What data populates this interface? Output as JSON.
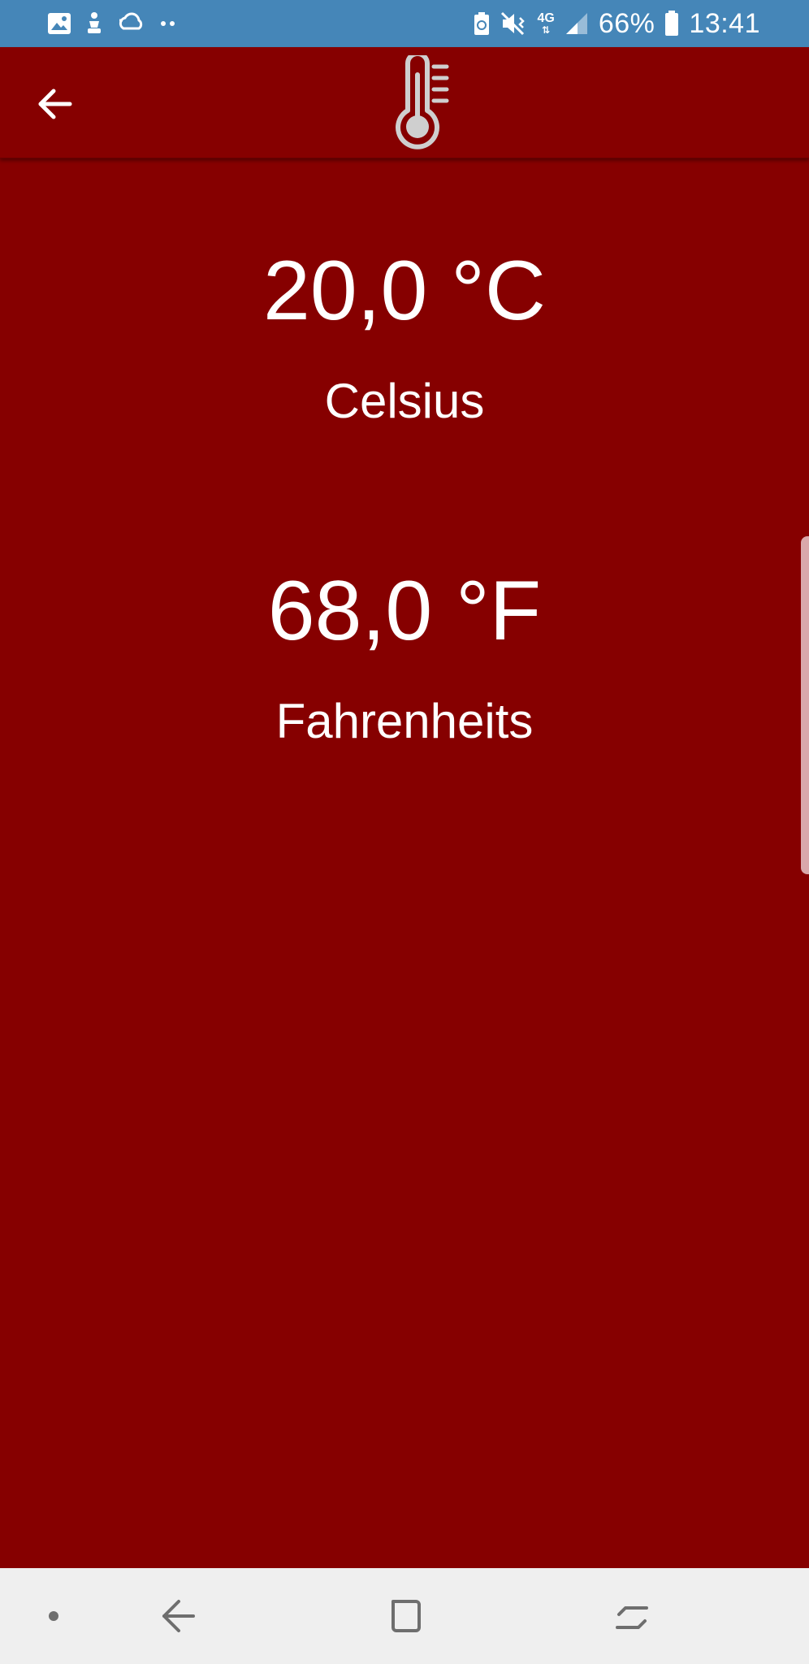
{
  "status_bar": {
    "battery_percent": "66%",
    "time": "13:41",
    "network_label": "4G",
    "icons": [
      "image-icon",
      "notification-figure-icon",
      "weather-cloud-icon",
      "more-dots-icon",
      "battery-saver-icon",
      "vibrate-mute-icon",
      "network-4g-icon",
      "signal-icon",
      "battery-icon"
    ]
  },
  "app_bar": {
    "back_icon": "arrow-left-icon",
    "logo_icon": "thermometer-icon"
  },
  "main": {
    "celsius": {
      "value": "20,0 °C",
      "label": "Celsius"
    },
    "fahrenheit": {
      "value": "68,0 °F",
      "label": "Fahrenheits"
    }
  },
  "nav_bar": {
    "icons": [
      "nav-dot-icon",
      "nav-back-icon",
      "nav-home-icon",
      "nav-recents-icon"
    ]
  },
  "colors": {
    "status_bar": "#4586b8",
    "background": "#860000",
    "text": "#ffffff",
    "nav_bar": "#efefef",
    "nav_icon": "#6e6e6e"
  }
}
